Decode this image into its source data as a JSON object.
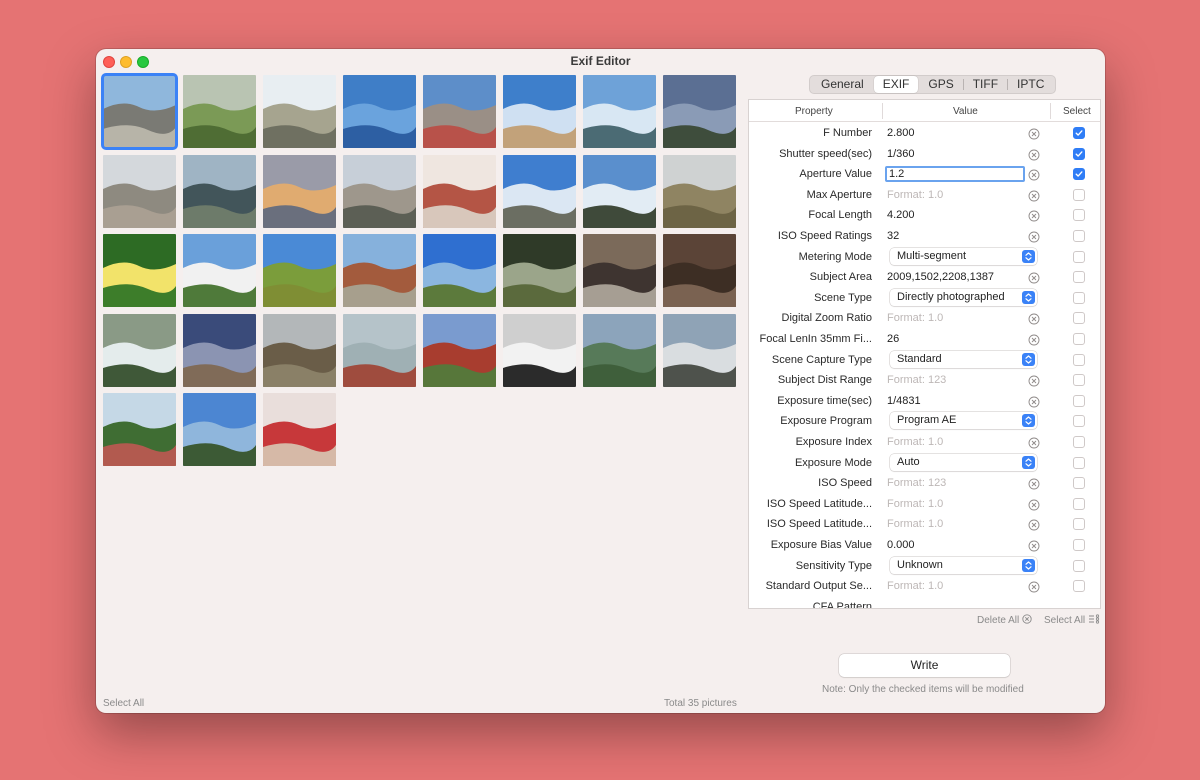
{
  "window": {
    "title": "Exif Editor"
  },
  "tabs": [
    {
      "label": "General",
      "active": false
    },
    {
      "label": "EXIF",
      "active": true
    },
    {
      "label": "GPS",
      "active": false
    },
    {
      "label": "TIFF",
      "active": false
    },
    {
      "label": "IPTC",
      "active": false
    }
  ],
  "table": {
    "headers": {
      "property": "Property",
      "value": "Value",
      "select": "Select"
    },
    "rows": [
      {
        "property": "F Number",
        "value": "2.800",
        "kind": "text",
        "checked": true
      },
      {
        "property": "Shutter speed(sec)",
        "value": "1/360",
        "kind": "text",
        "checked": true
      },
      {
        "property": "Aperture Value",
        "value": "1.2",
        "kind": "input",
        "checked": true
      },
      {
        "property": "Max Aperture",
        "value": "Format: 1.0",
        "kind": "placeholder",
        "checked": false
      },
      {
        "property": "Focal Length",
        "value": "4.200",
        "kind": "text",
        "checked": false
      },
      {
        "property": "ISO Speed Ratings",
        "value": "32",
        "kind": "text",
        "checked": false
      },
      {
        "property": "Metering Mode",
        "value": "Multi-segment",
        "kind": "select",
        "checked": false
      },
      {
        "property": "Subject Area",
        "value": "2009,1502,2208,1387",
        "kind": "text",
        "checked": false
      },
      {
        "property": "Scene Type",
        "value": "Directly photographed",
        "kind": "select",
        "checked": false
      },
      {
        "property": "Digital Zoom Ratio",
        "value": "Format: 1.0",
        "kind": "placeholder",
        "checked": false
      },
      {
        "property": "Focal LenIn 35mm Fi...",
        "value": "26",
        "kind": "text",
        "checked": false
      },
      {
        "property": "Scene Capture Type",
        "value": "Standard",
        "kind": "select",
        "checked": false
      },
      {
        "property": "Subject Dist Range",
        "value": "Format: 123",
        "kind": "placeholder",
        "checked": false
      },
      {
        "property": "Exposure time(sec)",
        "value": "1/4831",
        "kind": "text",
        "checked": false
      },
      {
        "property": "Exposure Program",
        "value": "Program AE",
        "kind": "select",
        "checked": false
      },
      {
        "property": "Exposure Index",
        "value": "Format: 1.0",
        "kind": "placeholder",
        "checked": false
      },
      {
        "property": "Exposure Mode",
        "value": "Auto",
        "kind": "select",
        "checked": false
      },
      {
        "property": "ISO Speed",
        "value": "Format: 123",
        "kind": "placeholder",
        "checked": false
      },
      {
        "property": "ISO Speed Latitude...",
        "value": "Format: 1.0",
        "kind": "placeholder",
        "checked": false
      },
      {
        "property": "ISO Speed Latitude...",
        "value": "Format: 1.0",
        "kind": "placeholder",
        "checked": false
      },
      {
        "property": "Exposure Bias Value",
        "value": "0.000",
        "kind": "text",
        "checked": false
      },
      {
        "property": "Sensitivity Type",
        "value": "Unknown",
        "kind": "select",
        "checked": false
      },
      {
        "property": "Standard Output Se...",
        "value": "Format: 1.0",
        "kind": "placeholder",
        "checked": false
      },
      {
        "property": "CFA Pattern",
        "value": "",
        "kind": "text",
        "checked": false
      }
    ]
  },
  "actions": {
    "delete_all": "Delete All",
    "select_all_right": "Select All"
  },
  "write": {
    "label": "Write",
    "note": "Note: Only the checked items will be modified"
  },
  "footer": {
    "select_all": "Select All",
    "total": "Total 35 pictures"
  },
  "thumbnails": [
    {
      "c1": "#8fb7dc",
      "c2": "#7a7a74",
      "c3": "#b7b4a8",
      "selected": true
    },
    {
      "c1": "#b9c4b2",
      "c2": "#7b9a56",
      "c3": "#4f6d34",
      "selected": false
    },
    {
      "c1": "#e8eef2",
      "c2": "#a6a48f",
      "c3": "#6f7061",
      "selected": false
    },
    {
      "c1": "#3f7ec7",
      "c2": "#6aa3dd",
      "c3": "#2d5fa3",
      "selected": false
    },
    {
      "c1": "#5d8ec9",
      "c2": "#9a8f86",
      "c3": "#b8524a",
      "selected": false
    },
    {
      "c1": "#3e7fcb",
      "c2": "#cfe0f2",
      "c3": "#c2a27a",
      "selected": false
    },
    {
      "c1": "#6ea2d8",
      "c2": "#d8e7f3",
      "c3": "#4b6b74",
      "selected": false
    },
    {
      "c1": "#5b6f93",
      "c2": "#8a9bb6",
      "c3": "#3e4d3c",
      "selected": false
    },
    {
      "c1": "#d4d8dc",
      "c2": "#8e8a80",
      "c3": "#a99f92",
      "selected": false
    },
    {
      "c1": "#9fb4c4",
      "c2": "#42555a",
      "c3": "#6d7b6a",
      "selected": false
    },
    {
      "c1": "#9a9ba8",
      "c2": "#e0ab70",
      "c3": "#6a6f7d",
      "selected": false
    },
    {
      "c1": "#c7cfd8",
      "c2": "#9e978c",
      "c3": "#5c5f55",
      "selected": false
    },
    {
      "c1": "#efe6e0",
      "c2": "#b45545",
      "c3": "#d8c7bb",
      "selected": false
    },
    {
      "c1": "#3f7ecf",
      "c2": "#dbe7f3",
      "c3": "#6b6e62",
      "selected": false
    },
    {
      "c1": "#5a8fcd",
      "c2": "#e2ecf4",
      "c3": "#3f4a3a",
      "selected": false
    },
    {
      "c1": "#cfd2d2",
      "c2": "#8f8462",
      "c3": "#6d6445",
      "selected": false
    },
    {
      "c1": "#2d6b24",
      "c2": "#f2e36a",
      "c3": "#3d7d2a",
      "selected": false
    },
    {
      "c1": "#6aa0da",
      "c2": "#f1f1f1",
      "c3": "#4f7a3a",
      "selected": false
    },
    {
      "c1": "#4a8ad6",
      "c2": "#7b9d3b",
      "c3": "#7f8e34",
      "selected": false
    },
    {
      "c1": "#86b1dc",
      "c2": "#a35b3d",
      "c3": "#a79f8d",
      "selected": false
    },
    {
      "c1": "#2f6fd0",
      "c2": "#8bb6e0",
      "c3": "#5c7a3c",
      "selected": false
    },
    {
      "c1": "#2f3a28",
      "c2": "#9ba58a",
      "c3": "#5b6a3d",
      "selected": false
    },
    {
      "c1": "#7b6a5a",
      "c2": "#3e3430",
      "c3": "#a69e93",
      "selected": false
    },
    {
      "c1": "#5b4437",
      "c2": "#3d2e24",
      "c3": "#7a6251",
      "selected": false
    },
    {
      "c1": "#8a9a86",
      "c2": "#e4ecec",
      "c3": "#3f5838",
      "selected": false
    },
    {
      "c1": "#3a4b7a",
      "c2": "#8b94b2",
      "c3": "#806b58",
      "selected": false
    },
    {
      "c1": "#b3b7b9",
      "c2": "#6a5d48",
      "c3": "#8a8067",
      "selected": false
    },
    {
      "c1": "#b5c3c9",
      "c2": "#9fb0b4",
      "c3": "#9f4c3e",
      "selected": false
    },
    {
      "c1": "#7a9bcf",
      "c2": "#a83d2f",
      "c3": "#57773a",
      "selected": false
    },
    {
      "c1": "#cfcfcf",
      "c2": "#f2f2f2",
      "c3": "#2b2b2b",
      "selected": false
    },
    {
      "c1": "#8ca4bb",
      "c2": "#577a59",
      "c3": "#3f5f3b",
      "selected": false
    },
    {
      "c1": "#8fa3b6",
      "c2": "#d9dde0",
      "c3": "#4e524c",
      "selected": false
    },
    {
      "c1": "#c5d8e6",
      "c2": "#3f6d33",
      "c3": "#b25a4f",
      "selected": false
    },
    {
      "c1": "#4c86d2",
      "c2": "#8fb6dc",
      "c3": "#3c5a35",
      "selected": false
    },
    {
      "c1": "#e9dedb",
      "c2": "#c7383a",
      "c3": "#d6b9a7",
      "selected": false
    }
  ],
  "colors": {
    "accent": "#2f7df6",
    "background": "#e57373"
  }
}
